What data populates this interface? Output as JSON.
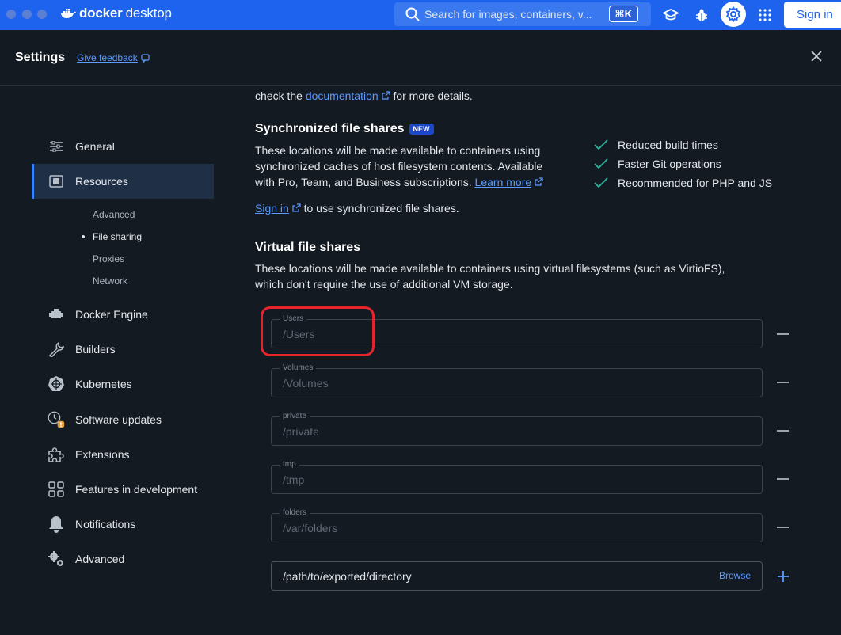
{
  "topbar": {
    "brand_bold": "docker",
    "brand_light": "desktop",
    "search_placeholder": "Search for images, containers, v...",
    "search_shortcut": "⌘K",
    "signin_label": "Sign in"
  },
  "header": {
    "title": "Settings",
    "feedback_label": "Give feedback"
  },
  "sidebar": {
    "items": [
      {
        "label": "General",
        "icon": "sliders-icon"
      },
      {
        "label": "Resources",
        "icon": "resources-icon"
      },
      {
        "label": "Docker Engine",
        "icon": "engine-icon"
      },
      {
        "label": "Builders",
        "icon": "wrench-icon"
      },
      {
        "label": "Kubernetes",
        "icon": "kubernetes-icon"
      },
      {
        "label": "Software updates",
        "icon": "clock-icon"
      },
      {
        "label": "Extensions",
        "icon": "puzzle-icon"
      },
      {
        "label": "Features in development",
        "icon": "grid-icon"
      },
      {
        "label": "Notifications",
        "icon": "bell-icon"
      },
      {
        "label": "Advanced",
        "icon": "cogs-icon"
      }
    ],
    "sub_items": [
      "Advanced",
      "File sharing",
      "Proxies",
      "Network"
    ]
  },
  "content": {
    "intro_prefix": "check the",
    "intro_link": "documentation",
    "intro_suffix": "for more details.",
    "sync_title": "Synchronized file shares",
    "sync_badge": "NEW",
    "sync_desc_1": "These locations will be made available to containers using",
    "sync_desc_2": "synchronized caches of host filesystem contents. Available",
    "sync_desc_3": "with Pro, Team, and Business subscriptions.",
    "sync_learn": "Learn more",
    "sync_signin": "Sign in",
    "sync_signin_suffix": "to use synchronized file shares.",
    "benefits": [
      "Reduced build times",
      "Faster Git operations",
      "Recommended for PHP and JS"
    ],
    "virtual_title": "Virtual file shares",
    "virtual_desc_1": "These locations will be made available to containers using virtual filesystems (such as VirtioFS),",
    "virtual_desc_2": "which don't require the use of additional VM storage.",
    "shares": [
      {
        "label": "Users",
        "value": "/Users"
      },
      {
        "label": "Volumes",
        "value": "/Volumes"
      },
      {
        "label": "private",
        "value": "/private"
      },
      {
        "label": "tmp",
        "value": "/tmp"
      },
      {
        "label": "folders",
        "value": "/var/folders"
      }
    ],
    "new_path_value": "/path/to/exported/directory",
    "browse_label": "Browse"
  }
}
